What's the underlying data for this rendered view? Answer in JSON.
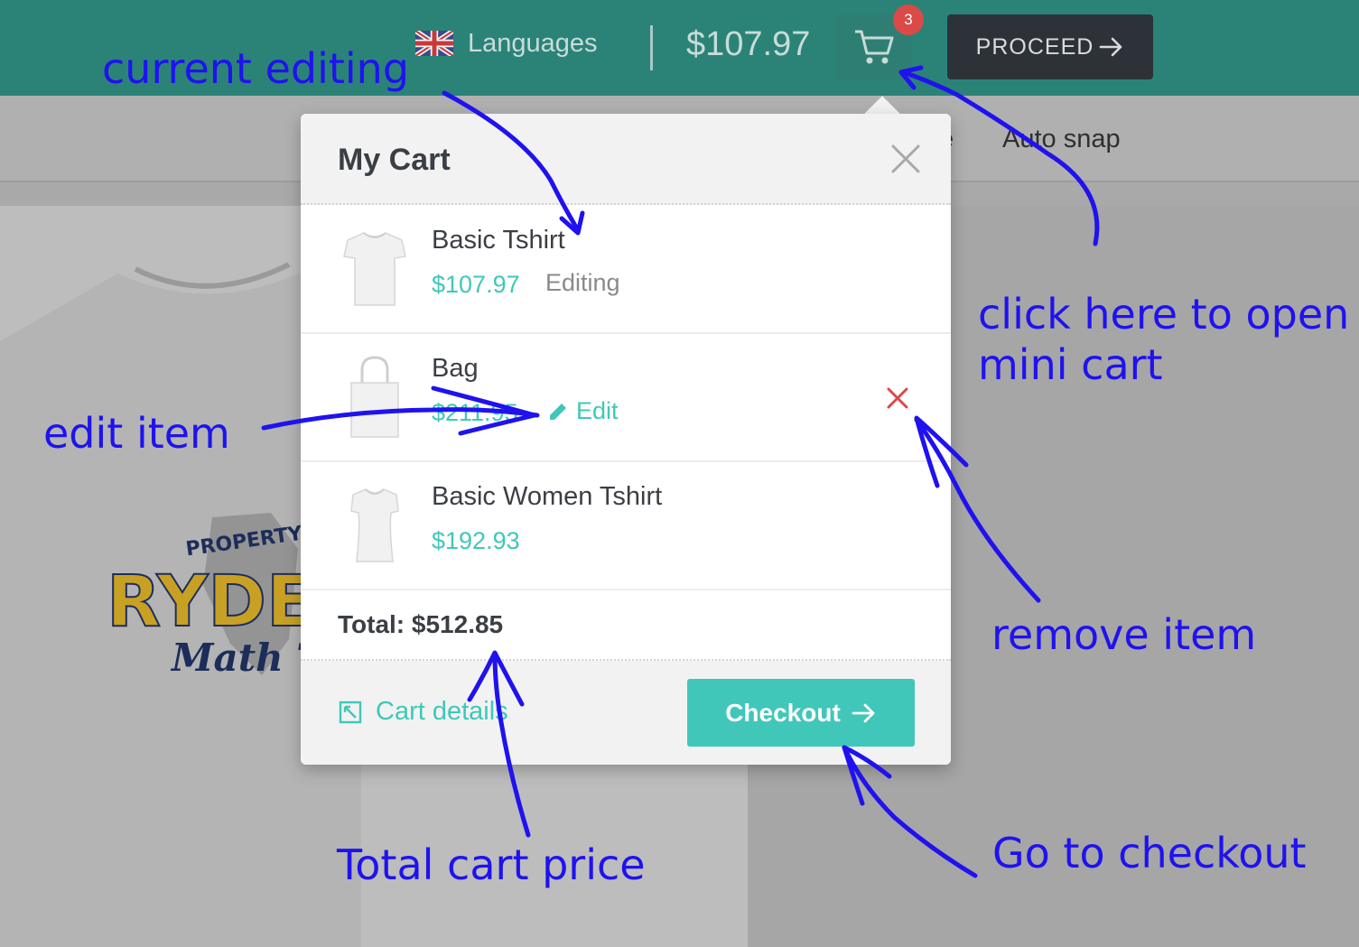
{
  "topbar": {
    "languages_label": "Languages",
    "cart_total": "$107.97",
    "cart_count": "3",
    "proceed_label": "PROCEED"
  },
  "subnav": {
    "items": [
      "e",
      "Auto snap"
    ]
  },
  "background_design": {
    "line1": "PROPERTY",
    "line2": "RYDE",
    "line3": "Math Te"
  },
  "mini_cart": {
    "title": "My Cart",
    "items": [
      {
        "name": "Basic Tshirt",
        "price": "$107.97",
        "status": "Editing",
        "thumb": "tshirt"
      },
      {
        "name": "Bag",
        "price": "$211.95",
        "edit_label": "Edit",
        "thumb": "bag"
      },
      {
        "name": "Basic Women Tshirt",
        "price": "$192.93",
        "thumb": "women-tshirt"
      }
    ],
    "total_label": "Total: $512.85",
    "cart_details_label": "Cart details",
    "checkout_label": "Checkout"
  },
  "annotations": {
    "current_editing": "current editing",
    "open_mini_cart_line1": "click here to open",
    "open_mini_cart_line2": "mini cart",
    "edit_item": "edit item",
    "remove_item": "remove item",
    "total_cart_price": "Total cart price",
    "go_to_checkout": "Go to checkout"
  },
  "colors": {
    "topbar": "#2b8378",
    "accent": "#41c7b9",
    "proceed": "#2d3238",
    "badge": "#d94a48",
    "remove": "#d94a48",
    "annotation": "#1f12ef"
  },
  "icons": [
    "uk-flag-icon",
    "cart-icon",
    "arrow-right-icon",
    "close-icon",
    "pencil-icon",
    "remove-icon",
    "expand-icon"
  ]
}
